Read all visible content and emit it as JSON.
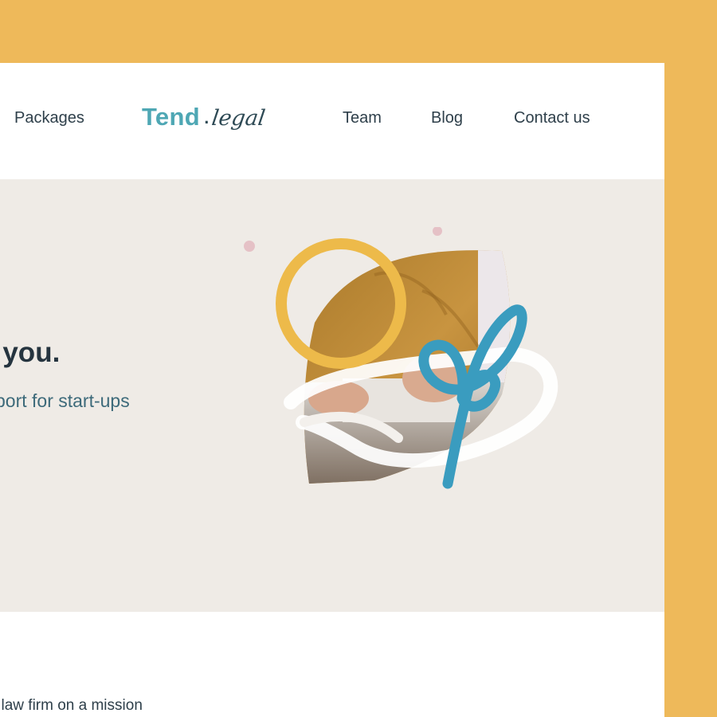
{
  "nav": {
    "items": [
      {
        "label": "Packages"
      },
      {
        "label": "Team"
      },
      {
        "label": "Blog"
      },
      {
        "label": "Contact us"
      }
    ],
    "logo": {
      "primary": "Tend",
      "dot": ".",
      "script": "legal"
    }
  },
  "hero": {
    "title_fragment": "r you.",
    "subtitle_fragment": "port for start-ups"
  },
  "section": {
    "text_fragment": "l law firm on a mission"
  },
  "colors": {
    "frame": "#EEB95A",
    "hero_bg": "#EFEBE6",
    "brand_teal": "#4EA7B4",
    "ring_yellow": "#EDBA4A",
    "brush_blue": "#3A9CBF"
  }
}
